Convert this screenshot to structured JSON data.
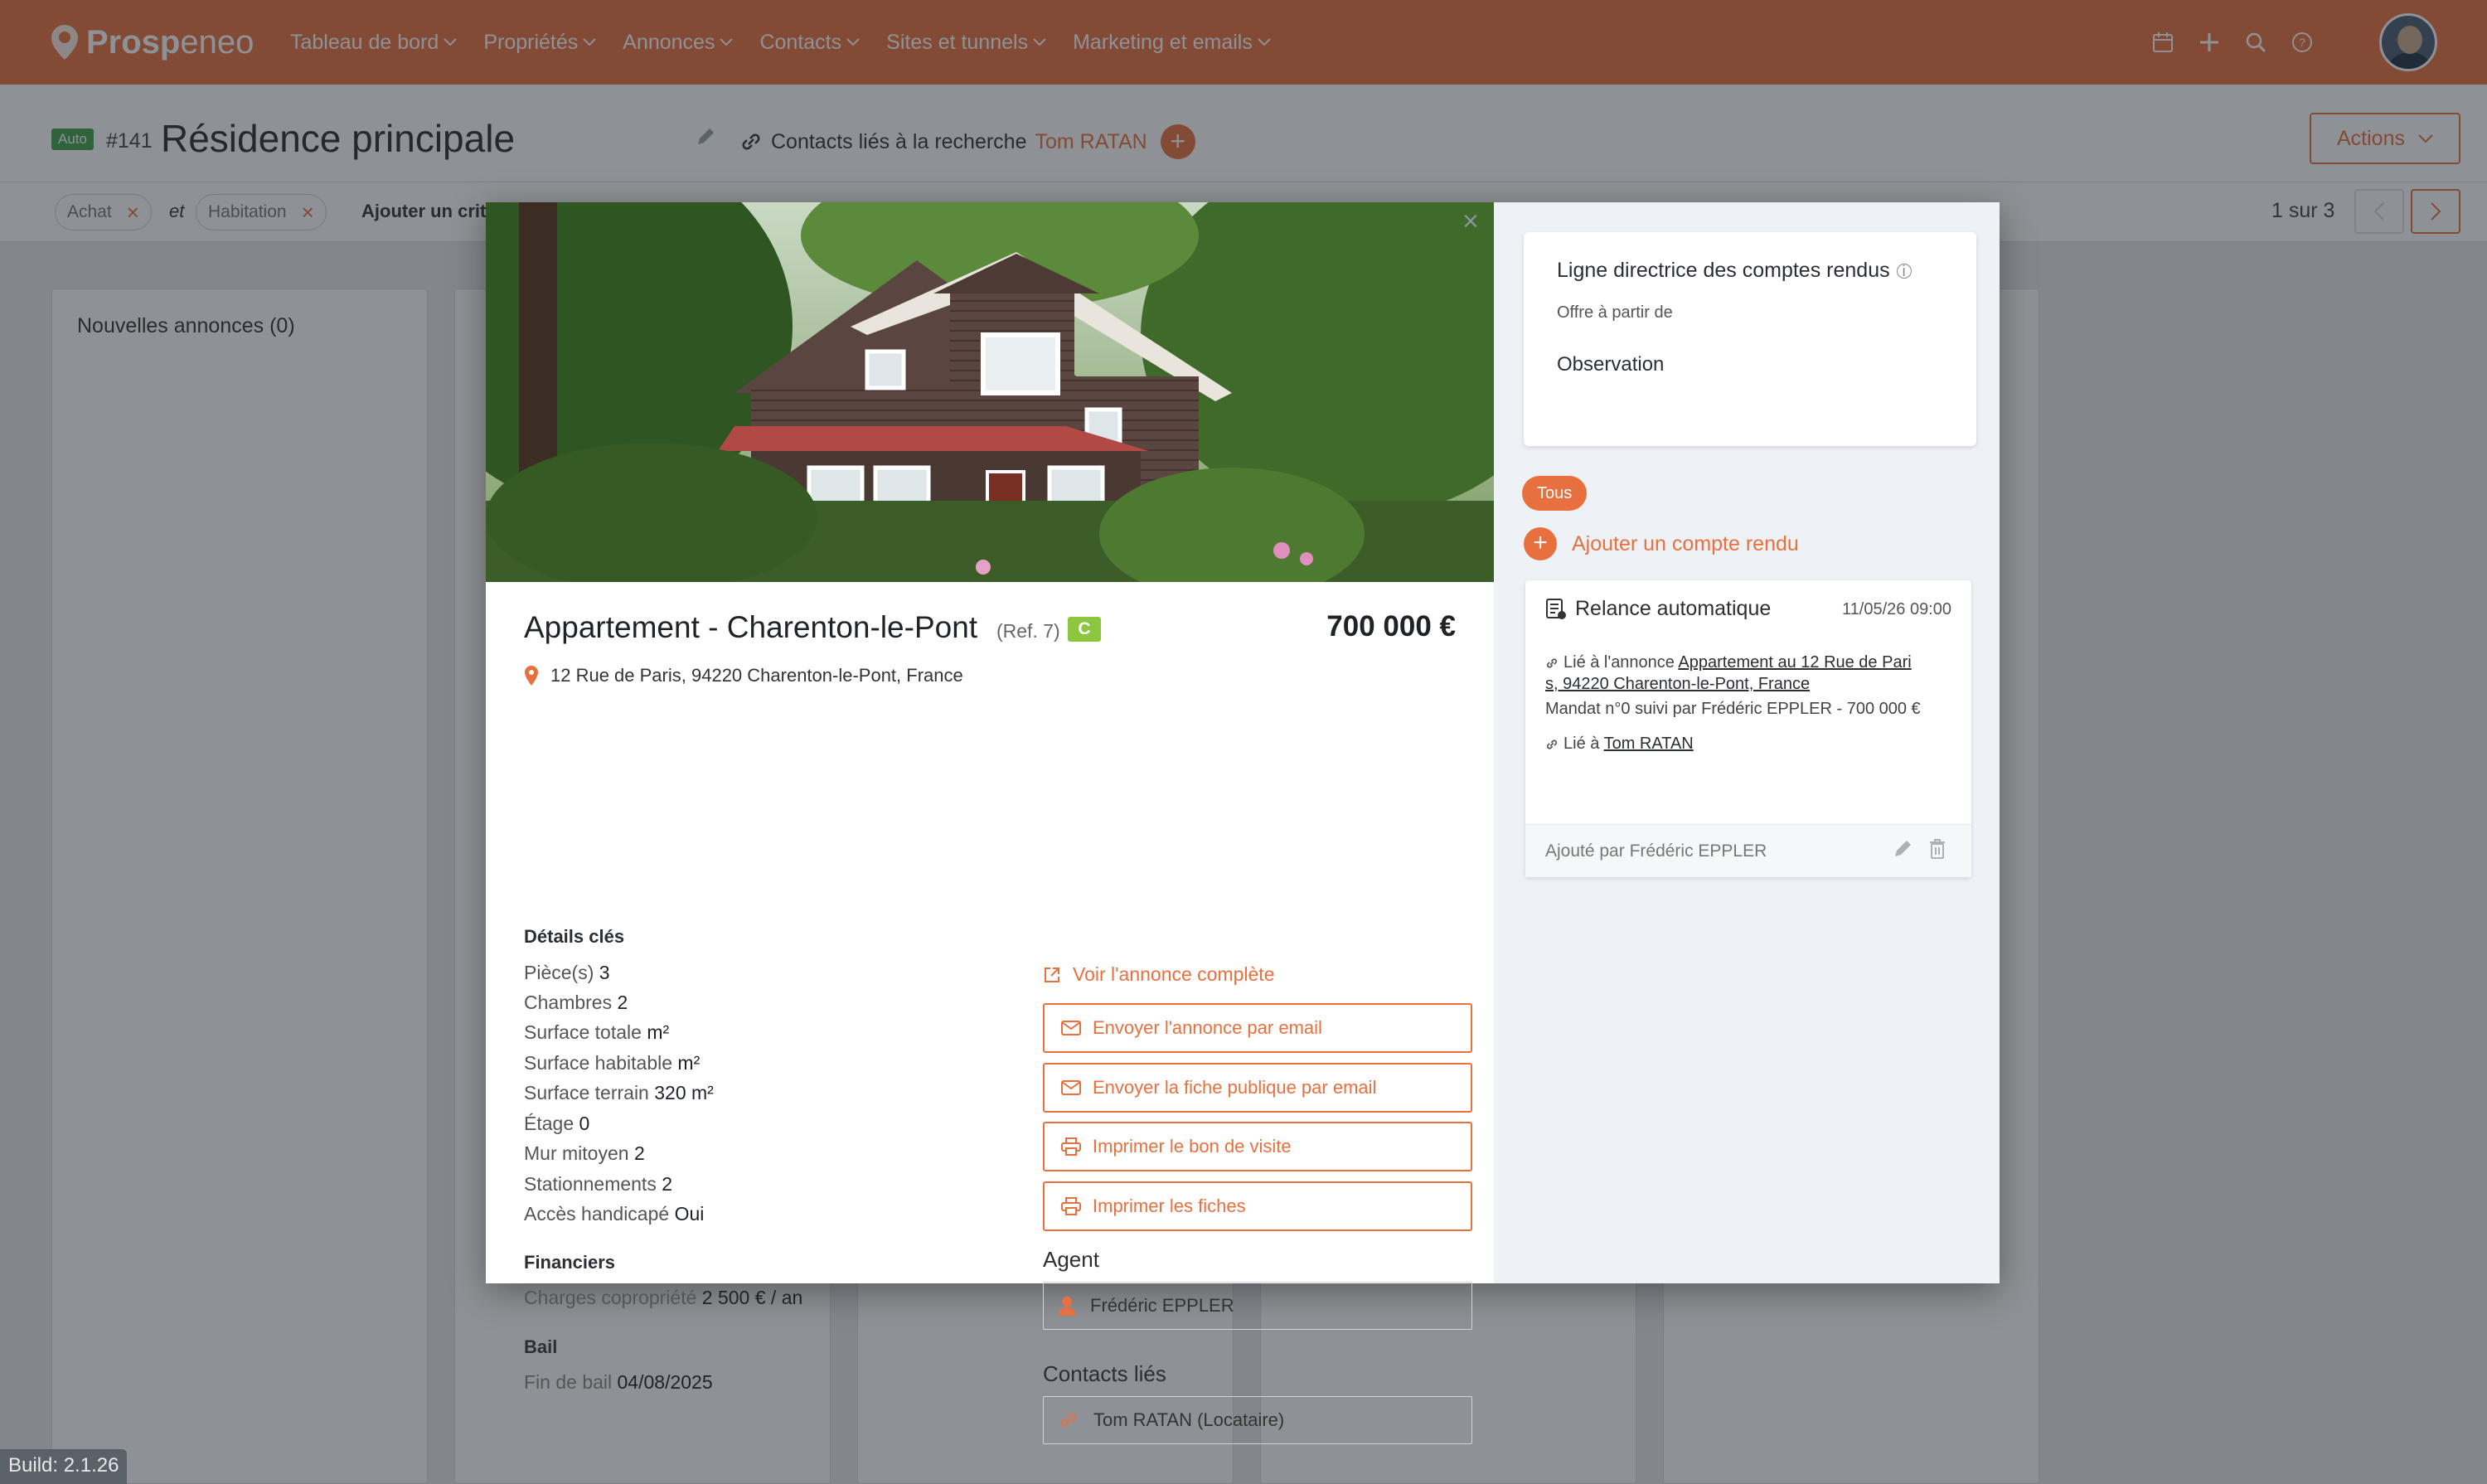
{
  "app": {
    "brand_main": "Prosp",
    "brand_accent": "eneo",
    "nav": [
      "Tableau de bord",
      "Propriétés",
      "Annonces",
      "Contacts",
      "Sites et tunnels",
      "Marketing et emails"
    ],
    "accent_color": "#e8703f"
  },
  "search": {
    "badge": "Auto",
    "id": "#141",
    "title": "Résidence principale",
    "linked_label": "Contacts liés à la recherche",
    "linked_name": "Tom RATAN",
    "actions_label": "Actions"
  },
  "filters": {
    "chips": [
      "Achat",
      "Habitation"
    ],
    "joiner": "et",
    "add_label": "Ajouter un critè",
    "pager": "1 sur 3"
  },
  "columns": {
    "first_title": "Nouvelles annonces (0)"
  },
  "build": "Build: 2.1.26",
  "modal": {
    "title": "Appartement - Charenton-le-Pont",
    "ref": "(Ref. 7)",
    "energy_class": "C",
    "price": "700 000 €",
    "address": "12 Rue de Paris, 94220 Charenton-le-Pont, France",
    "key_details": {
      "heading": "Détails clés",
      "rows": [
        {
          "label": "Pièce(s)",
          "value": "3"
        },
        {
          "label": "Chambres",
          "value": "2"
        },
        {
          "label": "Surface totale",
          "value": " m²"
        },
        {
          "label": "Surface habitable",
          "value": " m²"
        },
        {
          "label": "Surface terrain",
          "value": "320 m²"
        },
        {
          "label": "Étage",
          "value": "0"
        },
        {
          "label": "Mur mitoyen",
          "value": "2"
        },
        {
          "label": "Stationnements",
          "value": "2"
        },
        {
          "label": "Accès handicapé",
          "value": "Oui"
        }
      ]
    },
    "financial": {
      "heading": "Financiers",
      "rows": [
        {
          "label": "Charges copropriété",
          "value": "2 500 € / an"
        }
      ]
    },
    "lease": {
      "heading": "Bail",
      "rows": [
        {
          "label": "Fin de bail",
          "value": "04/08/2025"
        }
      ]
    },
    "view_full": "Voir l'annonce complète",
    "buttons": [
      {
        "label": "Envoyer l'annonce par email",
        "icon": "mail-icon"
      },
      {
        "label": "Envoyer la fiche publique par email",
        "icon": "mail-icon"
      },
      {
        "label": "Imprimer le bon de visite",
        "icon": "printer-icon"
      },
      {
        "label": "Imprimer les fiches",
        "icon": "printer-icon"
      }
    ],
    "agent_heading": "Agent",
    "agent_name": "Frédéric EPPLER",
    "contacts_heading": "Contacts liés",
    "contact_name": "Tom RATAN (Locataire)"
  },
  "side": {
    "guide_title": "Ligne directrice des comptes rendus",
    "guide_offer": "Offre à partir de",
    "guide_observation": "Observation",
    "filter_pill": "Tous",
    "add_report": "Ajouter un compte rendu",
    "report": {
      "title": "Relance automatique",
      "date": "11/05/26 09:00",
      "linked_prefix": "Lié à l'annonce",
      "linked_listing_1": "Appartement au 12 Rue de Pari",
      "linked_listing_2": "s, 94220 Charenton-le-Pont, France",
      "mandate": "Mandat n°0 suivi par Frédéric EPPLER - 700 000 €",
      "linked_contact_prefix": "Lié à",
      "linked_contact": "Tom RATAN",
      "added_by": "Ajouté par Frédéric EPPLER"
    }
  }
}
